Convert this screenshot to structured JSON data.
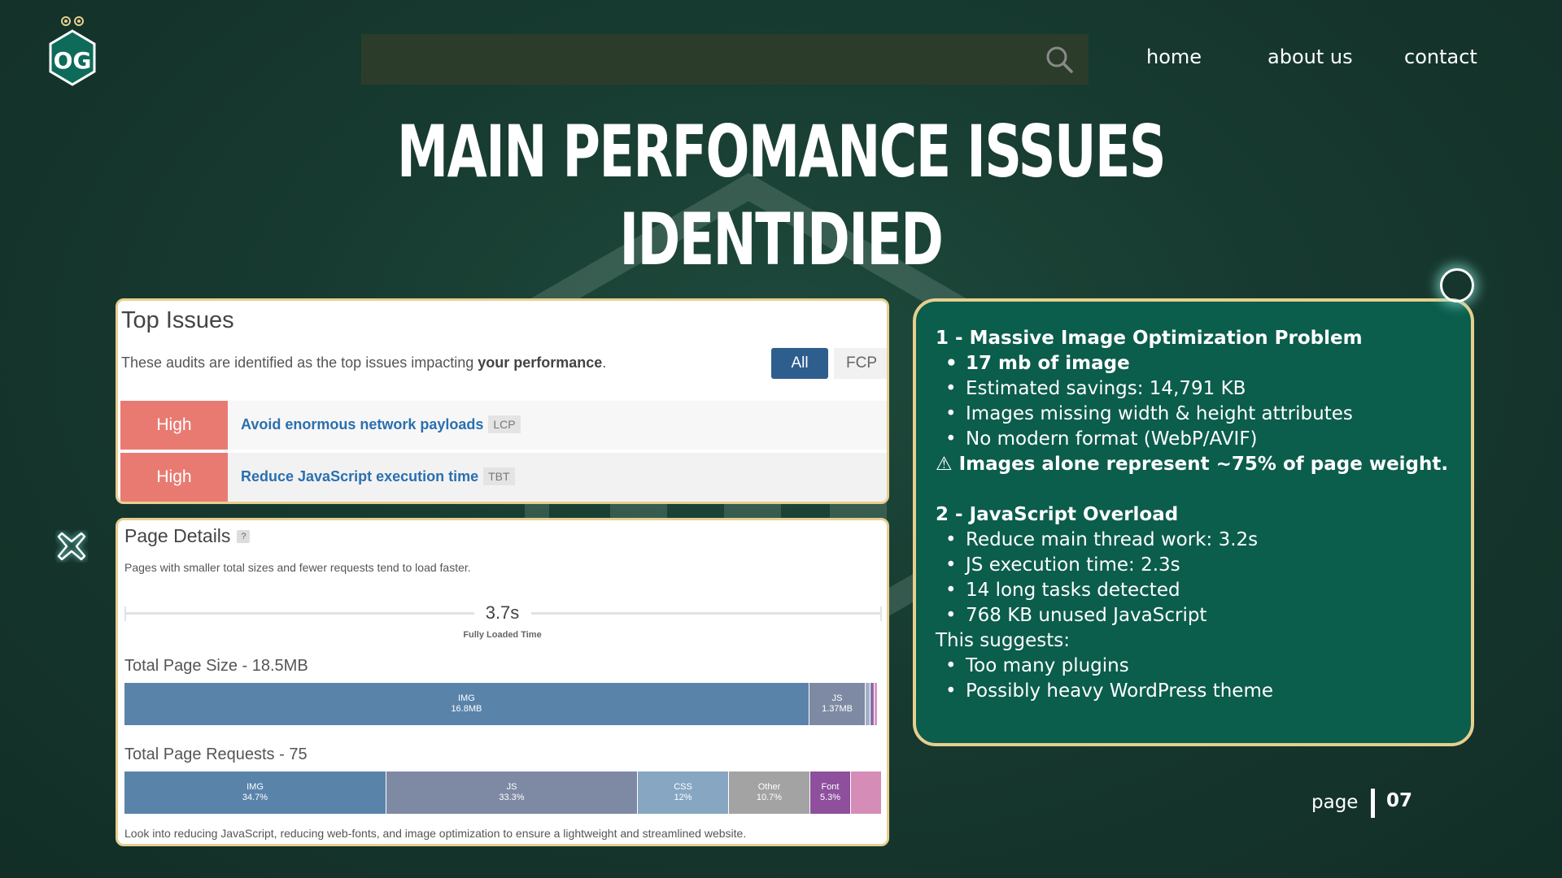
{
  "logo": {
    "text": "OG"
  },
  "search": {
    "value": "",
    "placeholder": ""
  },
  "nav": {
    "home": "home",
    "about": "about us",
    "contact": "contact"
  },
  "title": {
    "line1": "MAIN PERFOMANCE ISSUES",
    "line2": "IDENTIDIED"
  },
  "top_issues": {
    "title": "Top Issues",
    "description_prefix": "These audits are identified as the top issues impacting ",
    "description_bold": "your performance",
    "description_suffix": ".",
    "filters": [
      "All",
      "FCP"
    ],
    "rows": [
      {
        "severity": "High",
        "label": "Avoid enormous network payloads",
        "tag": "LCP"
      },
      {
        "severity": "High",
        "label": "Reduce JavaScript execution time",
        "tag": "TBT"
      }
    ]
  },
  "page_details": {
    "title": "Page Details",
    "help": "?",
    "description": "Pages with smaller total sizes and fewer requests tend to load faster.",
    "load_time": "3.7s",
    "load_time_label": "Fully Loaded Time",
    "size_heading": "Total Page Size - 18.5MB",
    "size_segments": [
      {
        "label": "IMG",
        "value": "16.8MB",
        "share": 0.908,
        "color": "#5a83aa"
      },
      {
        "label": "JS",
        "value": "1.37MB",
        "share": 0.074,
        "color": "#7e8aa3"
      },
      {
        "label": "",
        "value": "",
        "share": 0.005,
        "color": "#a0b0c8"
      },
      {
        "label": "",
        "value": "",
        "share": 0.004,
        "color": "#8e6aa8"
      },
      {
        "label": "",
        "value": "",
        "share": 0.004,
        "color": "#d796c0"
      }
    ],
    "requests_heading": "Total Page Requests - 75",
    "request_segments": [
      {
        "label": "IMG",
        "value": "34.7%",
        "share": 0.347,
        "color": "#5a83aa"
      },
      {
        "label": "JS",
        "value": "33.3%",
        "share": 0.333,
        "color": "#7e8aa3"
      },
      {
        "label": "CSS",
        "value": "12%",
        "share": 0.12,
        "color": "#86a6c2"
      },
      {
        "label": "Other",
        "value": "10.7%",
        "share": 0.107,
        "color": "#a3a3a3"
      },
      {
        "label": "Font",
        "value": "5.3%",
        "share": 0.053,
        "color": "#8e4f9c"
      },
      {
        "label": "",
        "value": "",
        "share": 0.04,
        "color": "#d58db8"
      }
    ],
    "footer": "Look into reducing JavaScript, reducing web-fonts, and image optimization to ensure a lightweight and streamlined website."
  },
  "info": {
    "section1_heading": "1 - Massive Image Optimization Problem",
    "section1_bold_item": "17 mb of image",
    "section1_items": [
      "Estimated savings: 14,791 KB",
      "Images missing width & height attributes",
      "No modern format (WebP/AVIF)"
    ],
    "warning": "⚠ Images alone represent ~75% of page weight.",
    "section2_heading": "2 - JavaScript Overload",
    "section2_items": [
      "Reduce main thread work: 3.2s",
      "JS execution time: 2.3s",
      "14 long tasks detected",
      "768 KB unused JavaScript"
    ],
    "suggests_label": "This suggests:",
    "suggests_items": [
      "Too many plugins",
      "Possibly heavy WordPress theme"
    ]
  },
  "pagination": {
    "label": "page",
    "number": "07"
  },
  "colors": {
    "background": "#173a30",
    "card": "#0b5d4c",
    "card_border": "#e6cf8e",
    "severity_high": "#e97a72",
    "link": "#2a6fb0",
    "filter_active": "#2d5e8e"
  }
}
